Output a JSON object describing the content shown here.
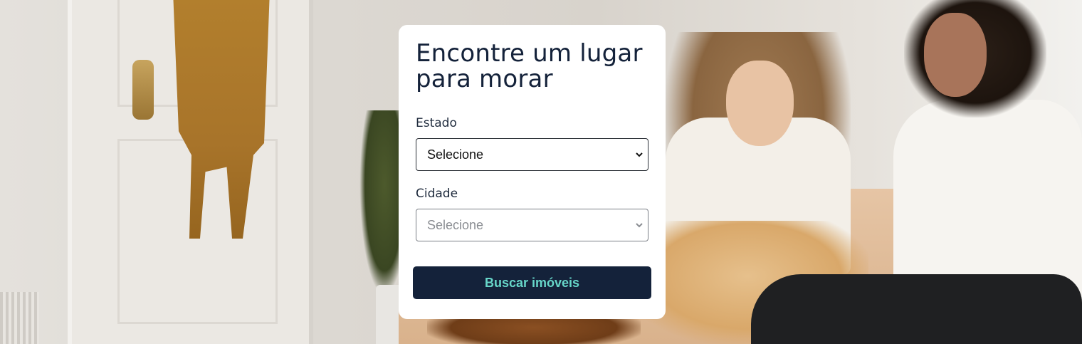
{
  "search_form": {
    "title": "Encontre um lugar para morar",
    "state_label": "Estado",
    "state_select_value": "Selecione",
    "city_label": "Cidade",
    "city_select_value": "Selecione",
    "submit_label": "Buscar imóveis"
  },
  "colors": {
    "title": "#14223a",
    "button_background": "#14223a",
    "button_text": "#67d6c9",
    "card_background": "#ffffff"
  },
  "icons": {
    "select_arrow": "chevron-down-icon"
  }
}
